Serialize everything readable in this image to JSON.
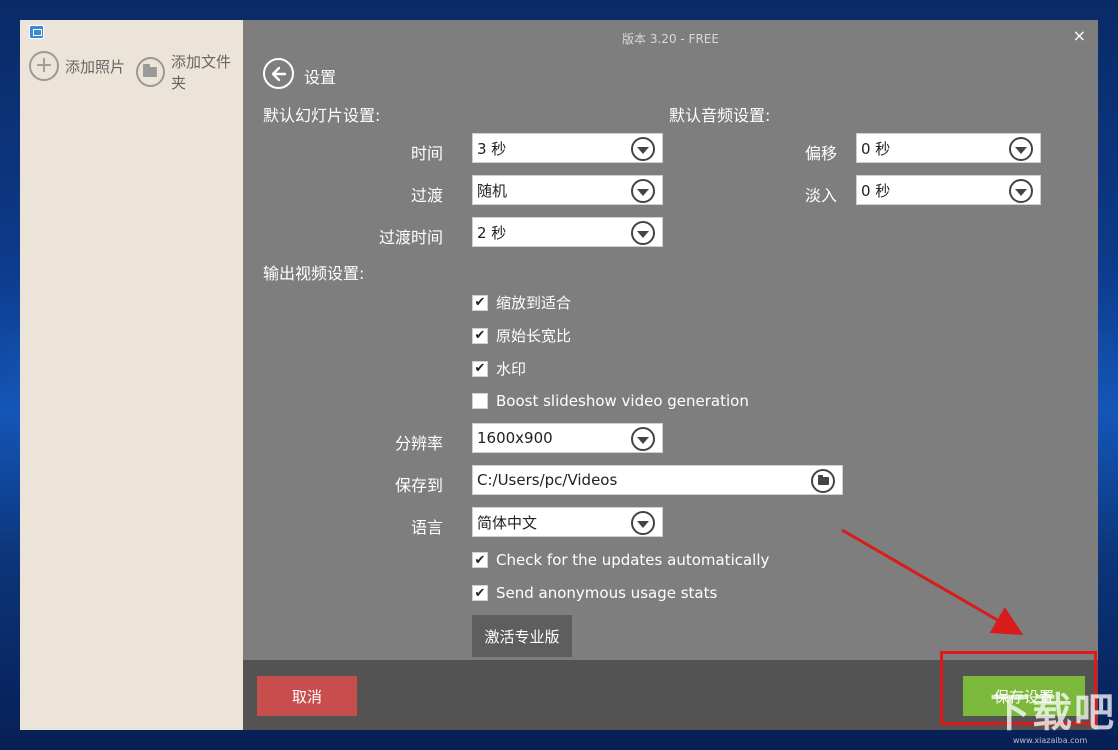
{
  "window": {
    "version_text": "版本 3.20 - FREE",
    "close_glyph": "×"
  },
  "left_panel": {
    "add_photos_label": "添加照片",
    "add_folder_label": "添加文件夹",
    "add_glyph": "+"
  },
  "settings": {
    "title": "设置",
    "slideshow_section": "默认幻灯片设置:",
    "audio_section": "默认音频设置:",
    "output_section": "输出视频设置:",
    "time_label": "时间",
    "time_value": "3 秒",
    "transition_label": "过渡",
    "transition_value": "随机",
    "transition_time_label": "过渡时间",
    "transition_time_value": "2 秒",
    "offset_label": "偏移",
    "offset_value": "0 秒",
    "fade_in_label": "淡入",
    "fade_in_value": "0 秒",
    "checkboxes": [
      {
        "label": "缩放到适合",
        "checked": true
      },
      {
        "label": "原始长宽比",
        "checked": true
      },
      {
        "label": "水印",
        "checked": true
      },
      {
        "label": "Boost slideshow video generation",
        "checked": false
      }
    ],
    "resolution_label": "分辨率",
    "resolution_value": "1600x900",
    "save_to_label": "保存到",
    "save_to_value": "C:/Users/pc/Videos",
    "language_label": "语言",
    "language_value": "简体中文",
    "update_check_label": "Check for the updates automatically",
    "update_check_checked": true,
    "usage_stats_label": "Send anonymous usage stats",
    "usage_stats_checked": true,
    "activate_label": "激活专业版",
    "check_glyph": "✔"
  },
  "footer": {
    "cancel_label": "取消",
    "save_label": "保存设置"
  },
  "annotation": {
    "highlight_color": "#e01818"
  },
  "watermark": {
    "text": "下载吧",
    "url": "www.xiazaiba.com"
  },
  "colors": {
    "cancel": "#c84e4e",
    "save": "#7cb83b",
    "overlay_bg": "#7e7e7e"
  }
}
